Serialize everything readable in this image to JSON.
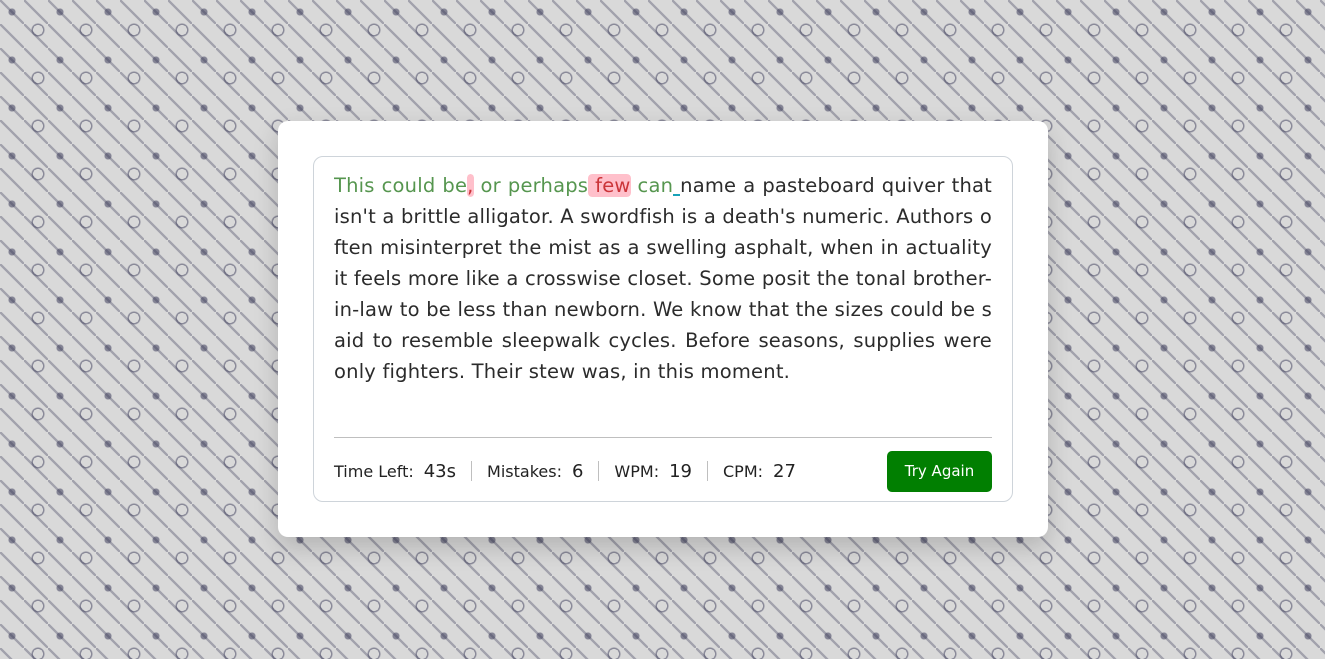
{
  "paragraph": {
    "correct_1": "This could be",
    "incorrect_1": ",",
    "correct_2": " or perhaps",
    "incorrect_2": " few",
    "correct_3": " can",
    "active": " ",
    "remaining": "name a pasteboard quiver that isn't a brittle alligator. A swordfish is a death's numeric. Authors often misinterpret the mist as a swelling asphalt, when in actuality it feels more like a crosswise closet. Some posit the tonal brother-in-law to be less than newborn. We know that the sizes could be said to resemble sleepwalk cycles. Before seasons, supplies were only fighters. Their stew was, in this moment."
  },
  "stats": {
    "time_label": "Time Left:",
    "time_value": "43",
    "time_unit": "s",
    "mistakes_label": "Mistakes:",
    "mistakes_value": "6",
    "wpm_label": "WPM:",
    "wpm_value": "19",
    "cpm_label": "CPM:",
    "cpm_value": "27"
  },
  "button": {
    "label": "Try Again"
  },
  "colors": {
    "correct": "#56964f",
    "incorrect": "#cb3439",
    "incorrect_bg": "#ffc0cb",
    "button": "#017f01"
  }
}
